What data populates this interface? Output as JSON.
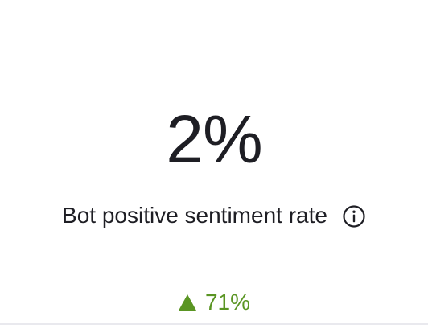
{
  "metric": {
    "value": "2%",
    "label": "Bot positive sentiment rate",
    "info_icon": "info-circle-icon",
    "delta": {
      "direction_icon": "triangle-up-icon",
      "value": "71%",
      "color": "#5a9523"
    }
  },
  "colors": {
    "text": "#1e1e24",
    "positive": "#5a9523",
    "background": "#ffffff",
    "divider": "#e9e9ee"
  }
}
